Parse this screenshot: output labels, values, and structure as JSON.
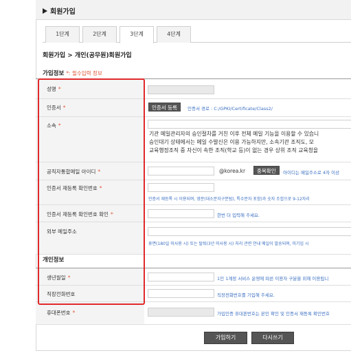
{
  "header": {
    "title": "회원가입"
  },
  "tabs": [
    {
      "label": "1단계"
    },
    {
      "label": "2단계"
    },
    {
      "label": "3단계"
    },
    {
      "label": "4단계"
    }
  ],
  "breadcrumb": "회원가입 > 개인(공무원)회원가입",
  "signup_info": {
    "title": "가입정보",
    "required_note": "*: 필수입력 정보"
  },
  "fields": {
    "name": {
      "label": "성명",
      "required": "*"
    },
    "certificate": {
      "label": "인증서",
      "required": "*",
      "button": "인증서 등록",
      "path_hint": "인증서 경로 : C:/GPKI/Certificate/Class2/"
    },
    "affiliation": {
      "label": "소속",
      "required": "*",
      "para1": "기관 메일관리자의 승인절차를 거친 이후 전체 메일 기능을 이용할 수 있습니",
      "para2": "승인대기 상태에서는 메일 수발신은 이용 가능하지만, 소속기관 조직도, 모",
      "para3": "교육행정조직 중 자신이 속한 조직(학교 등)이 없는 경우 상위 조직 교육청을"
    },
    "email_id": {
      "label": "공직자통합메일 아이디",
      "required": "*",
      "domain": "@korea.kr",
      "button": "중복확인",
      "hint": "아이디는 메일주소로 4자 이상"
    },
    "cert_pw": {
      "label": "인증서 재등록 확인번호",
      "required": "*",
      "hint": "인증서 재등록 시 이용되며, 영문(대소문자구분됨), 특수문자 포함)과 숫자 조합으로 9-12자리"
    },
    "cert_pw_confirm": {
      "label": "인증서 재등록 확인번호 확인",
      "required": "*",
      "hint": "한번 더 입력해 주세요."
    },
    "external_email": {
      "label": "외부 메일주소",
      "hint": "휴면(180일 미사용 시) 또는 탈퇴(3년 미사용 시) 처리 관련 안내 메일이 발송되며, 미기입 시"
    }
  },
  "personal_info": {
    "title": "개인정보",
    "birth": {
      "label": "생년월일",
      "required": "*",
      "hint": "1인 1계정 서비스 운영에 따른 이용자 구분을 위해 이용됩니"
    },
    "office_phone": {
      "label": "직장전화번호",
      "hint": "직장전화번호를 기입해 주세요."
    },
    "mobile": {
      "label": "휴대폰번호",
      "required": "*",
      "hint": "가입인증 휴대폰번호는 본인 확인 및 인증서 재등록 확인번호"
    }
  },
  "buttons": {
    "join": "가입하기",
    "rewrite": "다시쓰기"
  },
  "colors": {
    "required": "#e05a3a",
    "hint": "#3a6ec1",
    "highlight_box": "#e0282a",
    "dark_button": "#555555"
  }
}
